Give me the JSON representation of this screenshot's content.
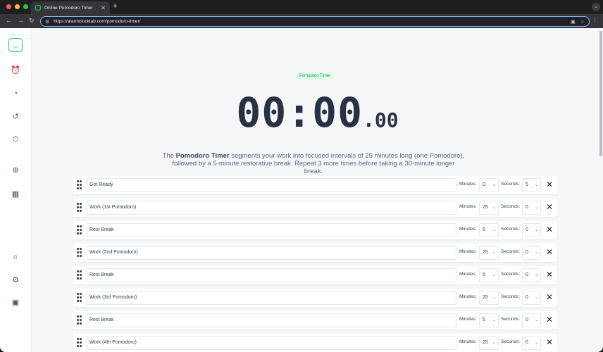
{
  "browser": {
    "tab_title": "Online Pomodoro Timer",
    "tab_close": "✕",
    "new_tab": "+",
    "url": "https://alarmclocktab.com/pomodoro-timer/"
  },
  "page": {
    "badge": "Pomodoro Timer",
    "timer_main": "00:00",
    "timer_fraction": ".00",
    "description_prefix": "The ",
    "description_bold": "Pomodoro Timer",
    "description_rest": " segments your work into focused intervals of 25 minutes long (one Pomodoro), followed by a 5-minute restorative break. Repeat 3 more times before taking a 30-minute longer break."
  },
  "labels": {
    "minutes": "Minutes:",
    "seconds": "Seconds:"
  },
  "intervals": [
    {
      "name": "Get Ready",
      "minutes": "0",
      "seconds": "5"
    },
    {
      "name": "Work (1st Pomodoro)",
      "minutes": "25",
      "seconds": "0"
    },
    {
      "name": "Rest Break",
      "minutes": "5",
      "seconds": "0"
    },
    {
      "name": "Work (2nd Pomodoro)",
      "minutes": "25",
      "seconds": "0"
    },
    {
      "name": "Rest Break",
      "minutes": "5",
      "seconds": "0"
    },
    {
      "name": "Work (3rd Pomodoro)",
      "minutes": "25",
      "seconds": "0"
    },
    {
      "name": "Rest Break",
      "minutes": "5",
      "seconds": "0"
    },
    {
      "name": "Work (4th Pomodoro)",
      "minutes": "25",
      "seconds": "0"
    }
  ],
  "sidebar_icons": [
    "alarm-clock-icon",
    "timer-icon",
    "history-icon",
    "stopwatch-icon",
    "globe-icon",
    "calendar-icon",
    "brightness-icon",
    "settings-icon",
    "contact-icon"
  ],
  "colors": {
    "accent": "#22c55e",
    "timer": "#283244",
    "text": "#334155"
  }
}
